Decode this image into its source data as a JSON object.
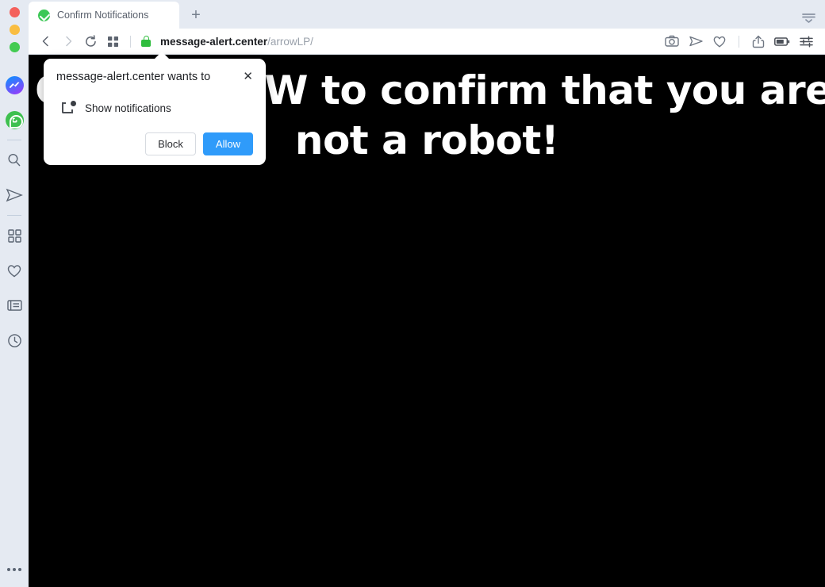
{
  "window": {
    "traffic_lights": [
      {
        "name": "close",
        "color": "#f4615c"
      },
      {
        "name": "minimize",
        "color": "#f9bd41"
      },
      {
        "name": "maximize",
        "color": "#43cb52"
      }
    ]
  },
  "sidebar": {
    "items": [
      {
        "name": "messenger",
        "icon": "messenger-icon",
        "label": "Messenger"
      },
      {
        "name": "whatsapp",
        "icon": "whatsapp-icon",
        "label": "WhatsApp"
      },
      {
        "name": "separator-1",
        "icon": "separator",
        "label": ""
      },
      {
        "name": "search",
        "icon": "search-icon",
        "label": "Search"
      },
      {
        "name": "telegram",
        "icon": "paper-plane-icon",
        "label": "Telegram"
      },
      {
        "name": "separator-2",
        "icon": "separator",
        "label": ""
      },
      {
        "name": "panels",
        "icon": "grid-icon",
        "label": "Panels"
      },
      {
        "name": "bookmarks",
        "icon": "heart-icon",
        "label": "Bookmarks"
      },
      {
        "name": "reading-list",
        "icon": "notes-icon",
        "label": "Notes"
      },
      {
        "name": "history",
        "icon": "clock-icon",
        "label": "History"
      }
    ],
    "more": {
      "icon": "more-dots-icon",
      "label": "More"
    }
  },
  "tabstrip": {
    "tabs": [
      {
        "title": "Confirm Notifications",
        "favicon": "green-check-icon",
        "active": true
      }
    ],
    "new_tab_label": "+",
    "tab_menu_icon": "tab-list-icon"
  },
  "toolbar": {
    "back_icon": "chevron-left-icon",
    "forward_icon": "chevron-right-icon",
    "reload_icon": "reload-icon",
    "panel_icon": "grid-icon",
    "security": {
      "icon": "lock-icon",
      "state": "secure",
      "color": "#2fbd3e"
    },
    "url": {
      "host": "message-alert.center",
      "path": "/arrowLP/"
    },
    "right_icons": [
      {
        "name": "capture-icon",
        "label": "Capture page"
      },
      {
        "name": "paper-plane-icon",
        "label": "Send"
      },
      {
        "name": "heart-icon",
        "label": "Add bookmark"
      },
      {
        "name": "share-icon",
        "label": "Share"
      },
      {
        "name": "battery-icon",
        "label": "Battery"
      },
      {
        "name": "sliders-icon",
        "label": "Page actions"
      }
    ]
  },
  "page": {
    "background": "#000000",
    "headline_line1": "Click ALLOW to confirm that you are",
    "headline_line2": "not a robot!"
  },
  "permission_dialog": {
    "title": "message-alert.center wants to",
    "close_label": "✕",
    "permission_icon": "show-notifications-icon",
    "permission_label": "Show notifications",
    "block_label": "Block",
    "allow_label": "Allow",
    "allow_color": "#2f9bfa"
  }
}
